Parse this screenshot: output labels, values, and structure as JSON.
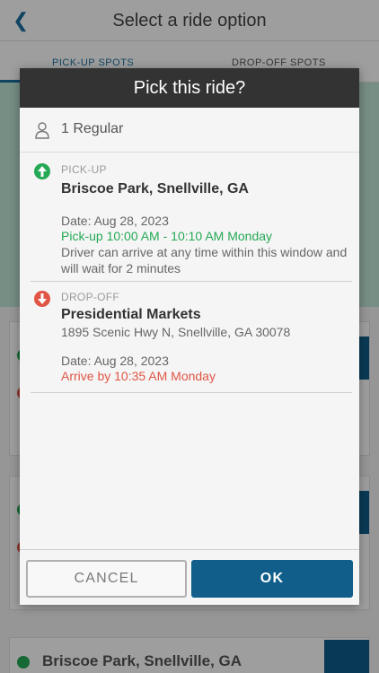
{
  "background": {
    "header_title": "Select a ride option",
    "back_icon": "chevron-left-icon",
    "tabs": [
      {
        "label": "PICK-UP SPOTS"
      },
      {
        "label": "DROP-OFF SPOTS"
      }
    ],
    "bottom_card_text": "Briscoe Park, Snellville, GA"
  },
  "modal": {
    "title": "Pick this ride?",
    "passenger": {
      "icon": "person-icon",
      "text": "1 Regular"
    },
    "pickup": {
      "icon": "arrow-up-circle-icon",
      "label": "PICK-UP",
      "name": "Briscoe Park, Snellville, GA",
      "date": "Date: Aug 28, 2023",
      "window": "Pick-up 10:00 AM - 10:10 AM Monday",
      "note": "Driver can arrive at any time within this window and will wait for 2 minutes"
    },
    "dropoff": {
      "icon": "arrow-down-circle-icon",
      "label": "DROP-OFF",
      "name": "Presidential Markets",
      "address": "1895 Scenic Hwy N, Snellville, GA 30078",
      "date": "Date: Aug 28, 2023",
      "window": "Arrive by 10:35 AM Monday"
    },
    "buttons": {
      "cancel": "CANCEL",
      "ok": "OK"
    }
  },
  "colors": {
    "primary": "#105e89",
    "pickup_green": "#25a955",
    "dropoff_red": "#e05545",
    "modal_header": "#333333"
  }
}
